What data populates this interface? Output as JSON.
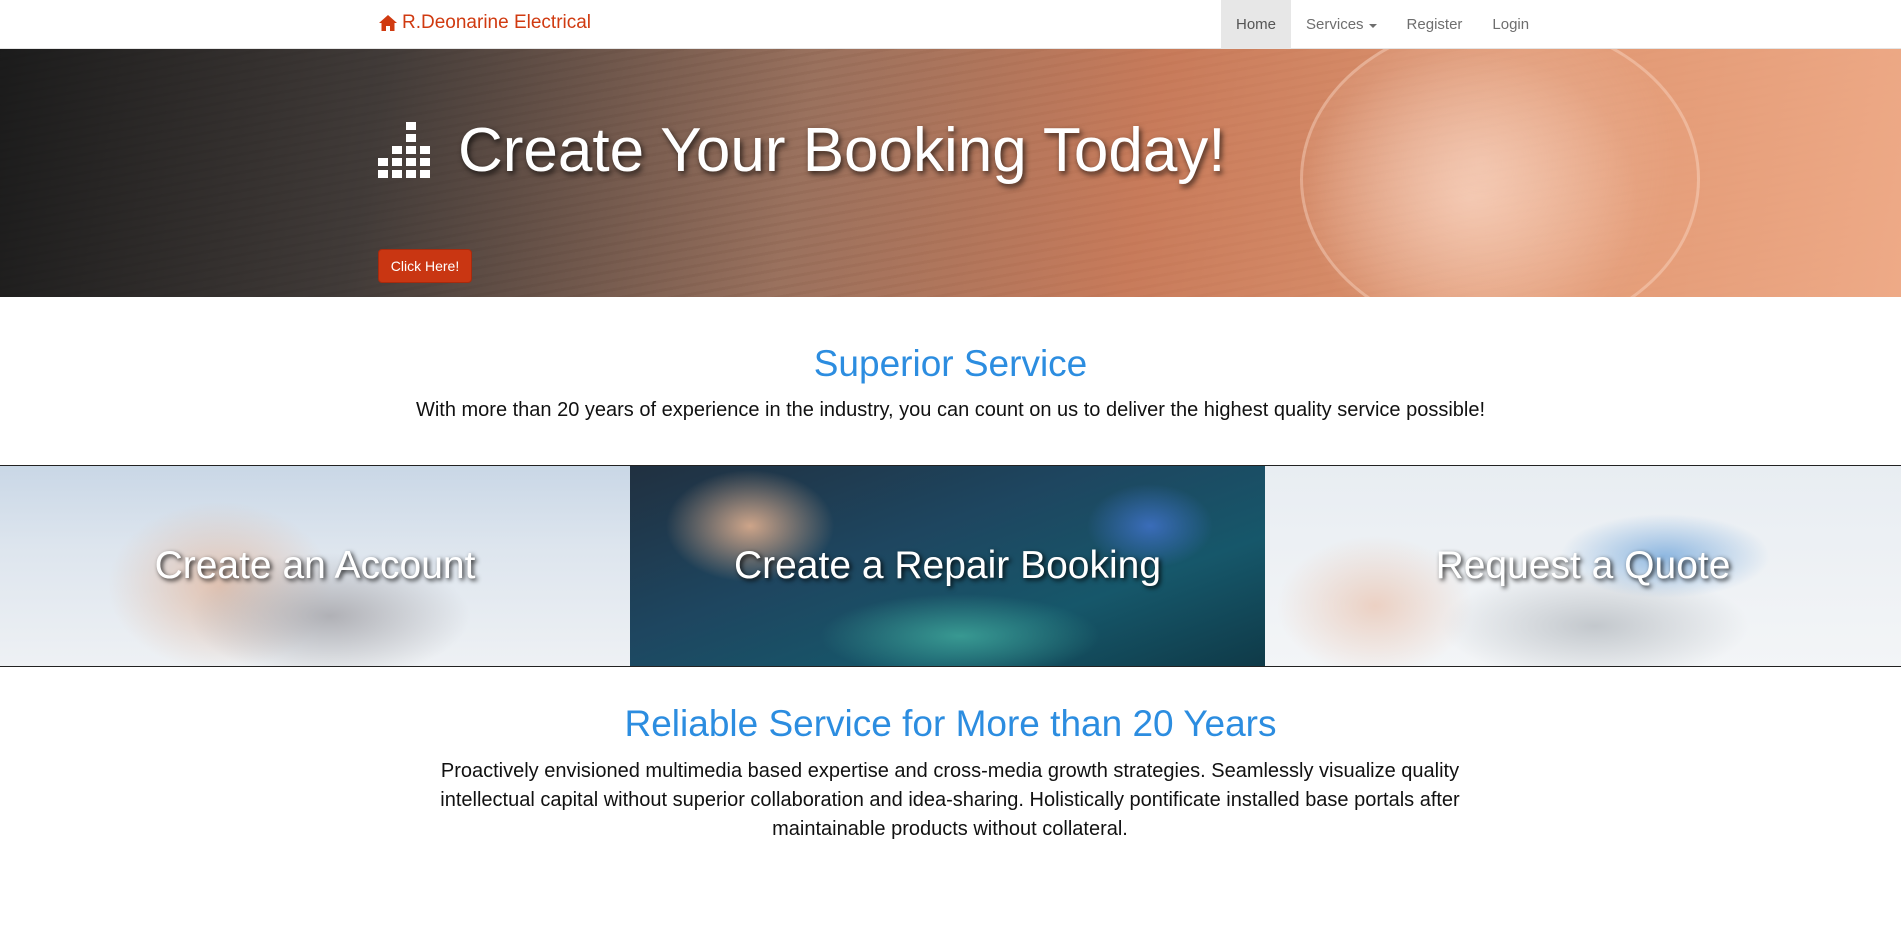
{
  "navbar": {
    "brand": "R.Deonarine Electrical",
    "brand_icon": "home-icon",
    "brand_color": "#d03a10",
    "items": [
      {
        "label": "Home",
        "active": true
      },
      {
        "label": "Services",
        "dropdown": true
      },
      {
        "label": "Register"
      },
      {
        "label": "Login"
      }
    ]
  },
  "hero": {
    "icon": "bar-chart-icon",
    "title": "Create Your Booking Today!",
    "button_label": "Click Here!",
    "button_color": "#c93612"
  },
  "superior": {
    "title": "Superior Service",
    "text": "With more than 20 years of experience in the industry, you can count on us to deliver the highest quality service possible!",
    "title_color": "#2c8de0"
  },
  "tiles": [
    {
      "label": "Create an Account"
    },
    {
      "label": "Create a Repair Booking"
    },
    {
      "label": "Request a Quote"
    }
  ],
  "reliable": {
    "title": "Reliable Service for More than 20 Years",
    "text": "Proactively envisioned multimedia based expertise and cross-media growth strategies. Seamlessly visualize quality intellectual capital without superior collaboration and idea-sharing. Holistically pontificate installed base portals after maintainable products without collateral."
  }
}
